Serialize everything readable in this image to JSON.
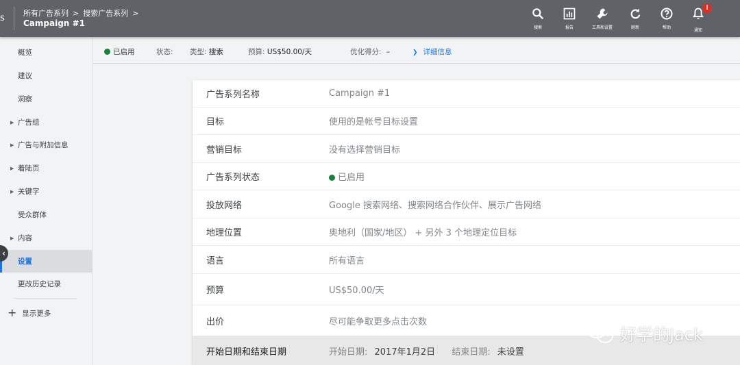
{
  "header": {
    "edge_letter": "s",
    "breadcrumb": [
      "所有广告系列",
      "搜索广告系列"
    ],
    "breadcrumb_sep": ">",
    "campaign_name": "Campaign #1",
    "tools": [
      {
        "label": "搜索",
        "icon": "search-icon"
      },
      {
        "label": "报告",
        "icon": "reports-icon"
      },
      {
        "label": "工具和设置",
        "icon": "wrench-icon"
      },
      {
        "label": "刷新",
        "icon": "refresh-icon"
      },
      {
        "label": "帮助",
        "icon": "help-icon"
      },
      {
        "label": "通知",
        "icon": "bell-icon"
      }
    ],
    "notification_badge": "!"
  },
  "sidebar": {
    "items": [
      {
        "label": "概览",
        "expandable": false
      },
      {
        "label": "建议",
        "expandable": false
      },
      {
        "label": "洞察",
        "expandable": false
      },
      {
        "label": "广告组",
        "expandable": true
      },
      {
        "label": "广告与附加信息",
        "expandable": true
      },
      {
        "label": "着陆页",
        "expandable": true
      },
      {
        "label": "关键字",
        "expandable": true
      },
      {
        "label": "受众群体",
        "expandable": false
      },
      {
        "label": "内容",
        "expandable": true
      },
      {
        "label": "设置",
        "expandable": false,
        "active": true
      },
      {
        "label": "更改历史记录",
        "expandable": false
      }
    ],
    "show_more": "显示更多"
  },
  "statusbar": {
    "enabled": "已启用",
    "status_label": "状态:",
    "type_label": "类型:",
    "type_value": "搜索",
    "budget_label": "预算:",
    "budget_value": "US$50.00/天",
    "optimization_label": "优化得分:",
    "optimization_value": "–",
    "details_link": "详细信息"
  },
  "settings": {
    "rows": [
      {
        "label": "广告系列名称",
        "value": "Campaign #1"
      },
      {
        "label": "目标",
        "value": "使用的是帐号目标设置"
      },
      {
        "label": "营销目标",
        "value": "没有选择营销目标"
      },
      {
        "label": "广告系列状态",
        "value": "已启用"
      },
      {
        "label": "投放网络",
        "value": "Google 搜索网络、搜索网络合作伙伴、展示广告网络"
      },
      {
        "label": "地理位置",
        "value": "奥地利（国家/地区） + 另外 3 个地理定位目标"
      },
      {
        "label": "语言",
        "value": "所有语言"
      },
      {
        "label": "预算",
        "value": "US$50.00/天"
      },
      {
        "label": "出价",
        "value": "尽可能争取更多点击次数"
      }
    ],
    "dates": {
      "label": "开始日期和结束日期",
      "start_label": "开始日期:",
      "start_value": "2017年1月2日",
      "end_label": "结束日期:",
      "end_value": "未设置"
    }
  },
  "watermark": "好学的Jack",
  "colors": {
    "header_bg": "#5f6368",
    "accent": "#1a73e8",
    "enabled_green": "#188038",
    "badge_red": "#d93025"
  }
}
